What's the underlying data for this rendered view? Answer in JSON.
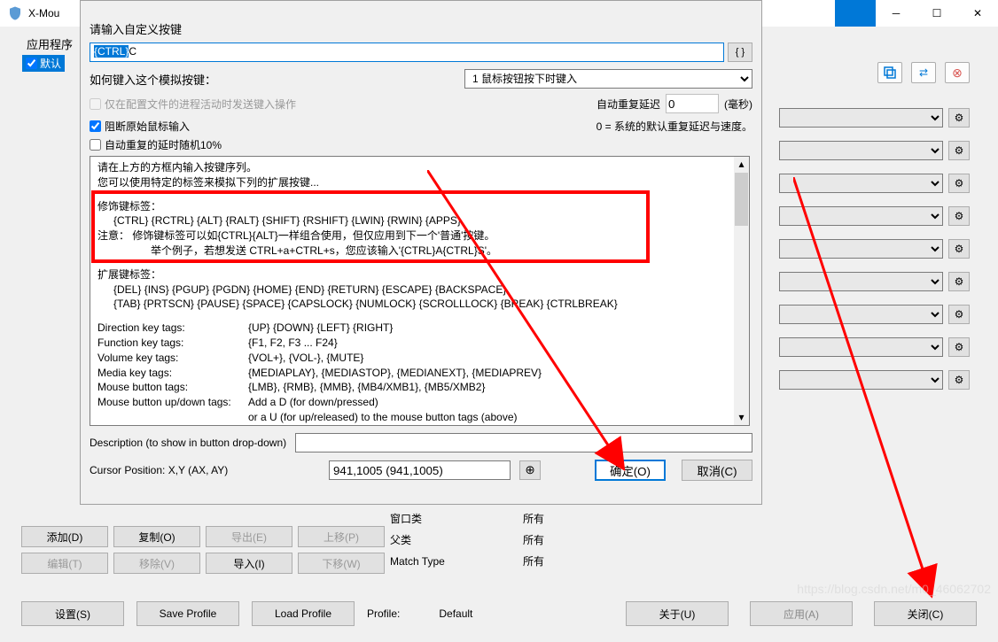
{
  "bgWindow": {
    "title": "X-Mou",
    "tabLabel": "应用程序",
    "defaultCheck": "默认"
  },
  "dialog": {
    "title": "请输入自定义按键",
    "keyInput": "{CTRL}C",
    "keyInputSelected": "{CTRL}",
    "howLabel": "如何键入这个模拟按键：",
    "howSelect": "1 鼠标按钮按下时键入",
    "onlyProcessCheck": "仅在配置文件的进程活动时发送键入操作",
    "autoRepeatLabel": "自动重复延迟",
    "autoRepeatValue": "0",
    "msLabel": "(毫秒)",
    "blockCheck": "阻断原始鼠标输入",
    "sysText": "0 = 系统的默认重复延迟与速度。",
    "randomCheck": "自动重复的延时随机10%",
    "helpText": {
      "line1": "请在上方的方框内输入按键序列。",
      "line2": "您可以使用特定的标签来模拟下列的扩展按键...",
      "modTitle": "修饰键标签：",
      "modKeys": "{CTRL} {RCTRL} {ALT} {RALT} {SHIFT} {RSHIFT} {LWIN} {RWIN} {APPS}",
      "modNote": "注意：  修饰键标签可以如{CTRL}{ALT}一样组合使用，但仅应用到下一个'普通'按键。",
      "modExample": "举个例子，若想发送 CTRL+a+CTRL+s，您应该输入'{CTRL}A{CTRL}S'。",
      "extTitle": "扩展键标签：",
      "extLine1": "{DEL} {INS} {PGUP} {PGDN} {HOME} {END} {RETURN} {ESCAPE} {BACKSPACE}",
      "extLine2": "{TAB} {PRTSCN} {PAUSE} {SPACE} {CAPSLOCK} {NUMLOCK} {SCROLLLOCK} {BREAK} {CTRLBREAK}",
      "dirLabel": "Direction key tags:",
      "dirKeys": "{UP} {DOWN} {LEFT} {RIGHT}",
      "funcLabel": "Function key tags:",
      "funcKeys": "{F1, F2, F3 ... F24}",
      "volLabel": "Volume key tags:",
      "volKeys": "{VOL+}, {VOL-}, {MUTE}",
      "mediaLabel": "Media key tags:",
      "mediaKeys": "{MEDIAPLAY}, {MEDIASTOP}, {MEDIANEXT}, {MEDIAPREV}",
      "mouseLabel": "Mouse button tags:",
      "mouseKeys": "{LMB}, {RMB}, {MMB}, {MB4/XMB1}, {MB5/XMB2}",
      "mouseUDLabel": "Mouse button up/down tags:",
      "mouseUD1": "Add a D (for down/pressed)",
      "mouseUD2": "or a U (for up/released) to the mouse button tags (above)"
    },
    "descLabel": "Description (to show in button drop-down)",
    "cursorLabel": "Cursor Position: X,Y (AX, AY)",
    "cursorValue": "941,1005 (941,1005)",
    "okBtn": "确定(O)",
    "cancelBtn": "取消(C)",
    "braceBtn": "{ }"
  },
  "bottomInfo": {
    "winClass": "窗口类",
    "winClassVal": "所有",
    "parentClass": "父类",
    "parentClassVal": "所有",
    "matchType": "Match Type",
    "matchTypeVal": "所有"
  },
  "appButtons": {
    "add": "添加(D)",
    "copy": "复制(O)",
    "export": "导出(E)",
    "moveUp": "上移(P)",
    "edit": "编辑(T)",
    "remove": "移除(V)",
    "import": "导入(I)",
    "moveDown": "下移(W)"
  },
  "footer": {
    "settings": "设置(S)",
    "saveProfile": "Save Profile",
    "loadProfile": "Load Profile",
    "profileLabel": "Profile:",
    "profileValue": "Default",
    "about": "关于(U)",
    "apply": "应用(A)",
    "close": "关闭(C)"
  },
  "watermark": "https://blog.csdn.net/m0_46062702",
  "icons": {
    "braces": "{ }",
    "swap": "⇄",
    "cross": "⊗",
    "gear": "⚙",
    "target": "⊕"
  }
}
